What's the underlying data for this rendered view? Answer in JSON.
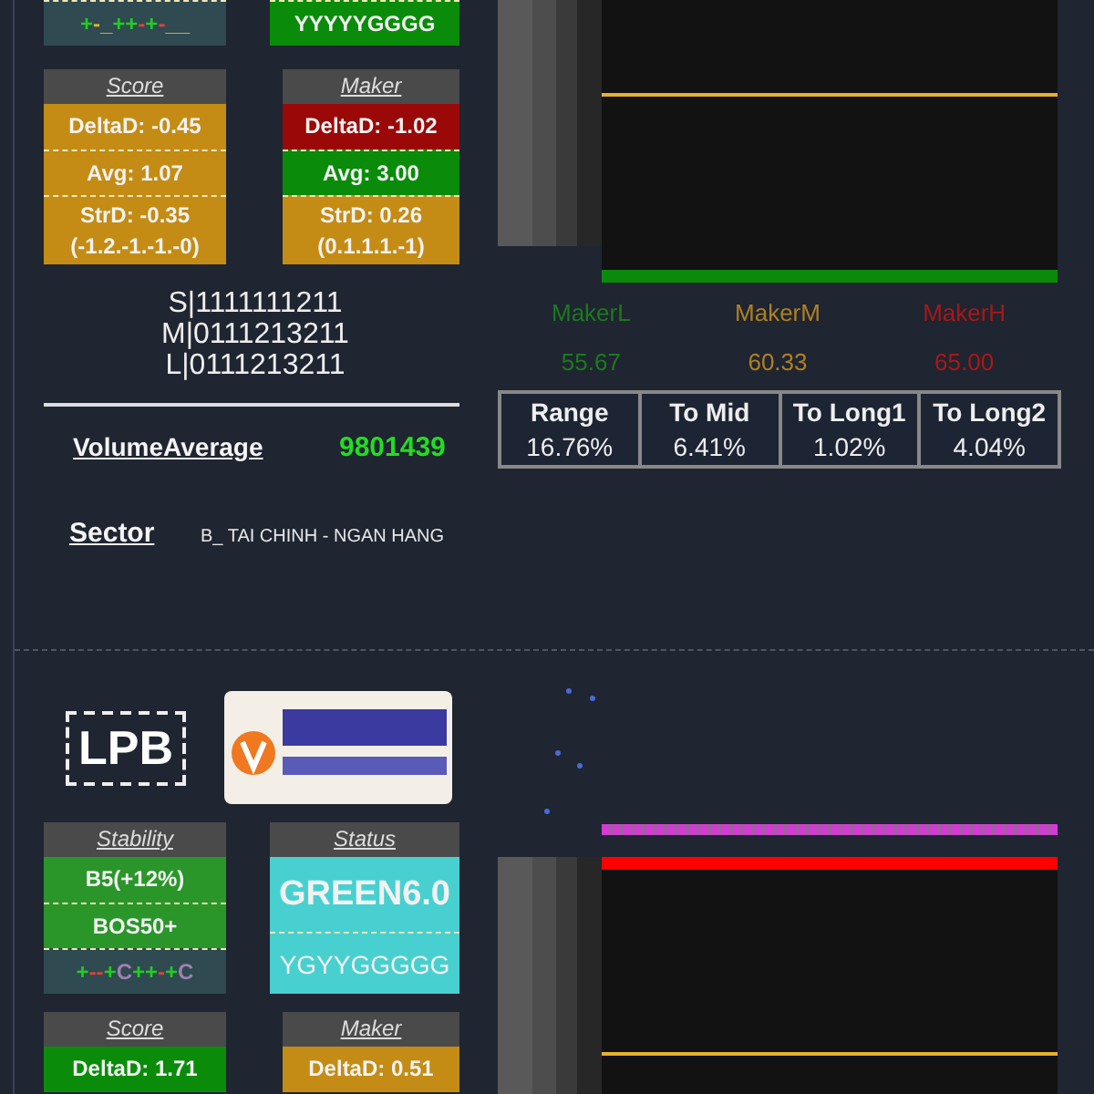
{
  "sections": [
    {
      "top_cards": [
        {
          "rows": [
            {
              "kind": "signals",
              "color": "#2f4a50",
              "signals": [
                {
                  "text": "+",
                  "color": "#22cc22"
                },
                {
                  "text": "-",
                  "color": "#e8b020"
                },
                {
                  "text": "_",
                  "color": "#e8b020"
                },
                {
                  "text": "++",
                  "color": "#22cc22"
                },
                {
                  "text": "-",
                  "color": "#e04040"
                },
                {
                  "text": "+",
                  "color": "#22cc22"
                },
                {
                  "text": "-",
                  "color": "#e04040"
                },
                {
                  "text": "__",
                  "color": "#e8b020"
                }
              ]
            }
          ]
        },
        {
          "rows": [
            {
              "kind": "text",
              "color": "#0a8c0a",
              "text": "YYYYYGGGG"
            }
          ]
        }
      ],
      "cards": [
        {
          "title": "Score",
          "rows": [
            {
              "kind": "text",
              "color": "#c48c14",
              "text": "DeltaD: -0.45"
            },
            {
              "kind": "text",
              "color": "#c48c14",
              "text": "Avg: 1.07"
            },
            {
              "kind": "text",
              "color": "#c48c14",
              "text": "StrD: -0.35",
              "note": "(-1.2.-1.-1.-0)"
            }
          ]
        },
        {
          "title": "Maker",
          "rows": [
            {
              "kind": "text",
              "color": "#9a0808",
              "text": "DeltaD: -1.02"
            },
            {
              "kind": "text",
              "color": "#0a8c0a",
              "text": "Avg: 3.00"
            },
            {
              "kind": "text",
              "color": "#c48c14",
              "text": "StrD: 0.26",
              "note": "(0.1.1.1.-1)"
            }
          ]
        }
      ],
      "codes": [
        "S|1111111211",
        "M|0111213211",
        "L|0111213211"
      ],
      "volume_average": {
        "label": "VolumeAverage",
        "value": "9801439"
      },
      "sector": {
        "label": "Sector",
        "value": "B_ TAI CHINH - NGAN HANG"
      },
      "band": {
        "kind": "bottom",
        "color": "#0a8a0a"
      },
      "makers": [
        {
          "label": "MakerL",
          "value": "55.67",
          "color": "#1c7a1c"
        },
        {
          "label": "MakerM",
          "value": "60.33",
          "color": "#b08022"
        },
        {
          "label": "MakerH",
          "value": "65.00",
          "color": "#a81818"
        }
      ],
      "stats": [
        {
          "label": "Range",
          "value": "16.76%"
        },
        {
          "label": "To Mid",
          "value": "6.41%"
        },
        {
          "label": "To Long1",
          "value": "1.02%"
        },
        {
          "label": "To Long2",
          "value": "4.04%"
        }
      ]
    },
    {
      "ticker": "LPB",
      "logo": true,
      "top_cards": [
        {
          "title": "Stability",
          "rows": [
            {
              "kind": "text",
              "color": "#2a962a",
              "text": "B5(+12%)"
            },
            {
              "kind": "text",
              "color": "#2a962a",
              "text": "BOS50+"
            },
            {
              "kind": "signals",
              "color": "#2f4a50",
              "signals": [
                {
                  "text": "+",
                  "color": "#22cc22"
                },
                {
                  "text": "--",
                  "color": "#e04040"
                },
                {
                  "text": "+",
                  "color": "#22cc22"
                },
                {
                  "text": "C",
                  "color": "#a080b0"
                },
                {
                  "text": "++",
                  "color": "#22cc22"
                },
                {
                  "text": "-",
                  "color": "#e04040"
                },
                {
                  "text": "+",
                  "color": "#22cc22"
                },
                {
                  "text": "C",
                  "color": "#a080b0"
                }
              ]
            }
          ]
        },
        {
          "title": "Status",
          "rows": [
            {
              "kind": "big",
              "color": "#48d0d0",
              "text": "GREEN6.0"
            },
            {
              "kind": "text",
              "color": "#48d0d0",
              "text": "YGYYGGGGG"
            }
          ]
        }
      ],
      "cards": [
        {
          "title": "Score",
          "rows": [
            {
              "kind": "text",
              "color": "#0a8c0a",
              "text": "DeltaD: 1.71"
            }
          ]
        },
        {
          "title": "Maker",
          "rows": [
            {
              "kind": "text",
              "color": "#c48c14",
              "text": "DeltaD: 0.51"
            }
          ]
        }
      ],
      "band": {
        "kind": "top",
        "color": "#ff0000"
      },
      "strip": true
    }
  ]
}
